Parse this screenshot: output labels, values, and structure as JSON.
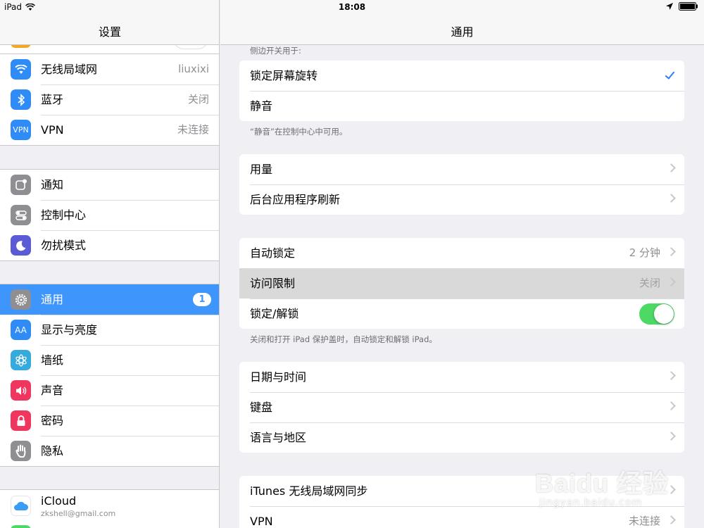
{
  "status_bar": {
    "device": "iPad",
    "time": "18:08"
  },
  "left": {
    "title": "设置",
    "group1": [
      {
        "label": "无线局域网",
        "value": "liuxixi",
        "icon": "wifi-icon",
        "color": "#2f8cf7"
      },
      {
        "label": "蓝牙",
        "value": "关闭",
        "icon": "bluetooth-icon",
        "color": "#2f8cf7"
      },
      {
        "label": "VPN",
        "value": "未连接",
        "icon": "vpn-icon",
        "icon_text": "VPN",
        "color": "#2f8cf7"
      }
    ],
    "group2": [
      {
        "label": "通知",
        "icon": "notifications-icon",
        "color": "#8e8e93"
      },
      {
        "label": "控制中心",
        "icon": "control-center-icon",
        "color": "#8e8e93"
      },
      {
        "label": "勿扰模式",
        "icon": "moon-icon",
        "color": "#5b5bd6"
      }
    ],
    "group3": [
      {
        "label": "通用",
        "badge": "1",
        "icon": "gear-icon",
        "color": "#8e8e93",
        "selected": true
      },
      {
        "label": "显示与亮度",
        "icon": "brightness-icon",
        "icon_text": "AA",
        "color": "#2f8cf7"
      },
      {
        "label": "墙纸",
        "icon": "wallpaper-icon",
        "color": "#35aadc"
      },
      {
        "label": "声音",
        "icon": "speaker-icon",
        "color": "#f0365e"
      },
      {
        "label": "密码",
        "icon": "lock-icon",
        "color": "#f0365e"
      },
      {
        "label": "隐私",
        "icon": "hand-icon",
        "color": "#8e8e93"
      }
    ],
    "icloud": {
      "label": "iCloud",
      "email": "zkshell@gmail.com"
    }
  },
  "right": {
    "title": "通用",
    "side_switch_header": "侧边开关用于:",
    "side_switch": [
      {
        "label": "锁定屏幕旋转",
        "checked": true
      },
      {
        "label": "静音",
        "checked": false
      }
    ],
    "side_switch_note": "“静音”在控制中心中可用。",
    "group2": [
      {
        "label": "用量"
      },
      {
        "label": "后台应用程序刷新"
      }
    ],
    "group3": [
      {
        "label": "自动锁定",
        "value": "2 分钟"
      },
      {
        "label": "访问限制",
        "value": "关闭"
      },
      {
        "label": "锁定/解锁",
        "toggle": true
      }
    ],
    "lock_note": "关闭和打开 iPad 保护盖时，自动锁定和解锁 iPad。",
    "group4": [
      {
        "label": "日期与时间"
      },
      {
        "label": "键盘"
      },
      {
        "label": "语言与地区"
      }
    ],
    "group5": [
      {
        "label": "iTunes 无线局域网同步"
      },
      {
        "label": "VPN",
        "value": "未连接"
      }
    ]
  },
  "watermark": {
    "brand": "Baidu 经验",
    "sub": "jingyan.baidu.com"
  }
}
